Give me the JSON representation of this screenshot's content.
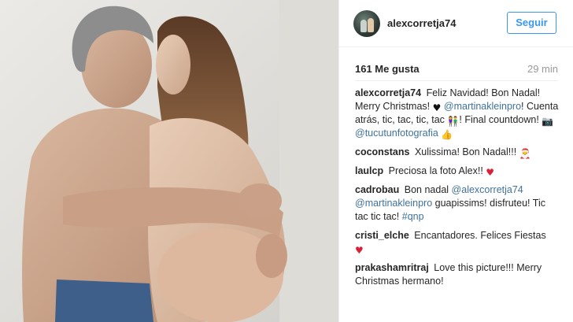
{
  "header": {
    "username": "alexcorretja74",
    "follow_label": "Seguir"
  },
  "meta": {
    "likes": "161 Me gusta",
    "time": "29 min"
  },
  "caption": {
    "user": "alexcorretja74",
    "t1": "Feliz Navidad! Bon Nadal! Merry Christmas!",
    "m1": "@martinakleinpro",
    "t2": "! Cuenta atrás, tic, tac, tic, tac",
    "t3": "! Final countdown!",
    "m2": "@tucutunfotografia"
  },
  "comments": [
    {
      "user": "coconstans",
      "text": "Xulissima! Bon Nadal!!!"
    },
    {
      "user": "laulcp",
      "text": "Preciosa la foto Alex!!"
    },
    {
      "user": "cadrobau",
      "text": "Bon nadal",
      "m1": "@alexcorretja74",
      "m2": "@martinakleinpro",
      "text2": "guapissims! disfruteu! Tic tac tic tac!",
      "tag": "#qnp"
    },
    {
      "user": "cristi_elche",
      "text": "Encantadores. Felices Fiestas"
    },
    {
      "user": "prakashamritraj",
      "text": "Love this picture!!! Merry Christmas hermano!"
    }
  ],
  "icons": {
    "heart_black": "♥",
    "heart_red": "♥",
    "camera": "📷",
    "couple": "👫",
    "thumbs": "👍",
    "santa": "🎅"
  },
  "colors": {
    "accent_blue": "#3897f0",
    "mention_blue": "#3f729b",
    "time_gray": "#999999",
    "heart_red": "#d8203b"
  }
}
